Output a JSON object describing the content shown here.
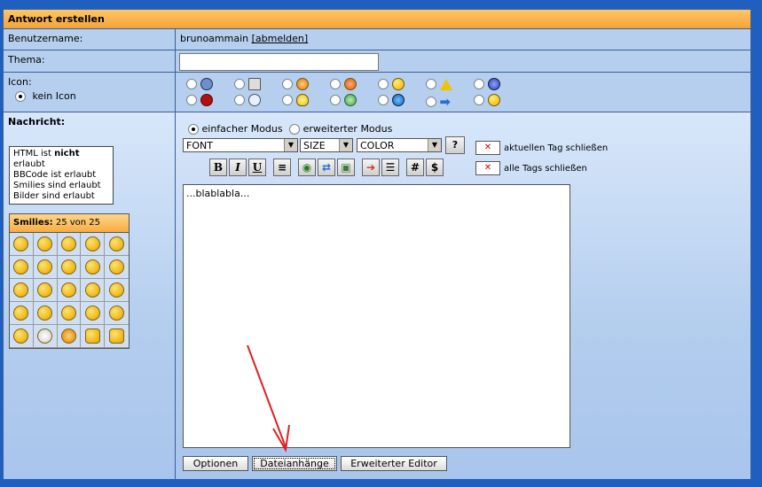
{
  "header": {
    "title": "Antwort erstellen"
  },
  "user": {
    "label": "Benutzername:",
    "name": "brunoammain",
    "logout": "[abmelden]"
  },
  "subject": {
    "label": "Thema:",
    "value": ""
  },
  "icon": {
    "label": "Icon:",
    "none_label": "kein Icon"
  },
  "message": {
    "label": "Nachricht:",
    "mode_simple": "einfacher Modus",
    "mode_extended": "erweiterter Modus",
    "font_select": "FONT",
    "size_select": "SIZE",
    "color_select": "COLOR",
    "close_tag": "aktuellen Tag schließen",
    "close_all_tags": "alle Tags schließen",
    "body": "...blablabla...",
    "toolbar": {
      "bold": "B",
      "italic": "I",
      "underline": "U",
      "hash": "#",
      "dollar": "$"
    }
  },
  "info": {
    "html_prefix": "HTML ist ",
    "html_bold": "nicht",
    "html_suffix": " erlaubt",
    "bbcode": "BBCode ist erlaubt",
    "smilies": "Smilies sind erlaubt",
    "images": "Bilder sind erlaubt"
  },
  "smilies": {
    "title_bold": "Smilies:",
    "count": "25 von 25"
  },
  "buttons": {
    "options": "Optionen",
    "attachments": "Dateianhänge",
    "advanced_editor": "Erweiterter Editor"
  },
  "colors": {
    "header": "#f3a43a",
    "background": "#b6cfee",
    "border": "#3a5e98",
    "annotation_arrow": "#e02020"
  }
}
